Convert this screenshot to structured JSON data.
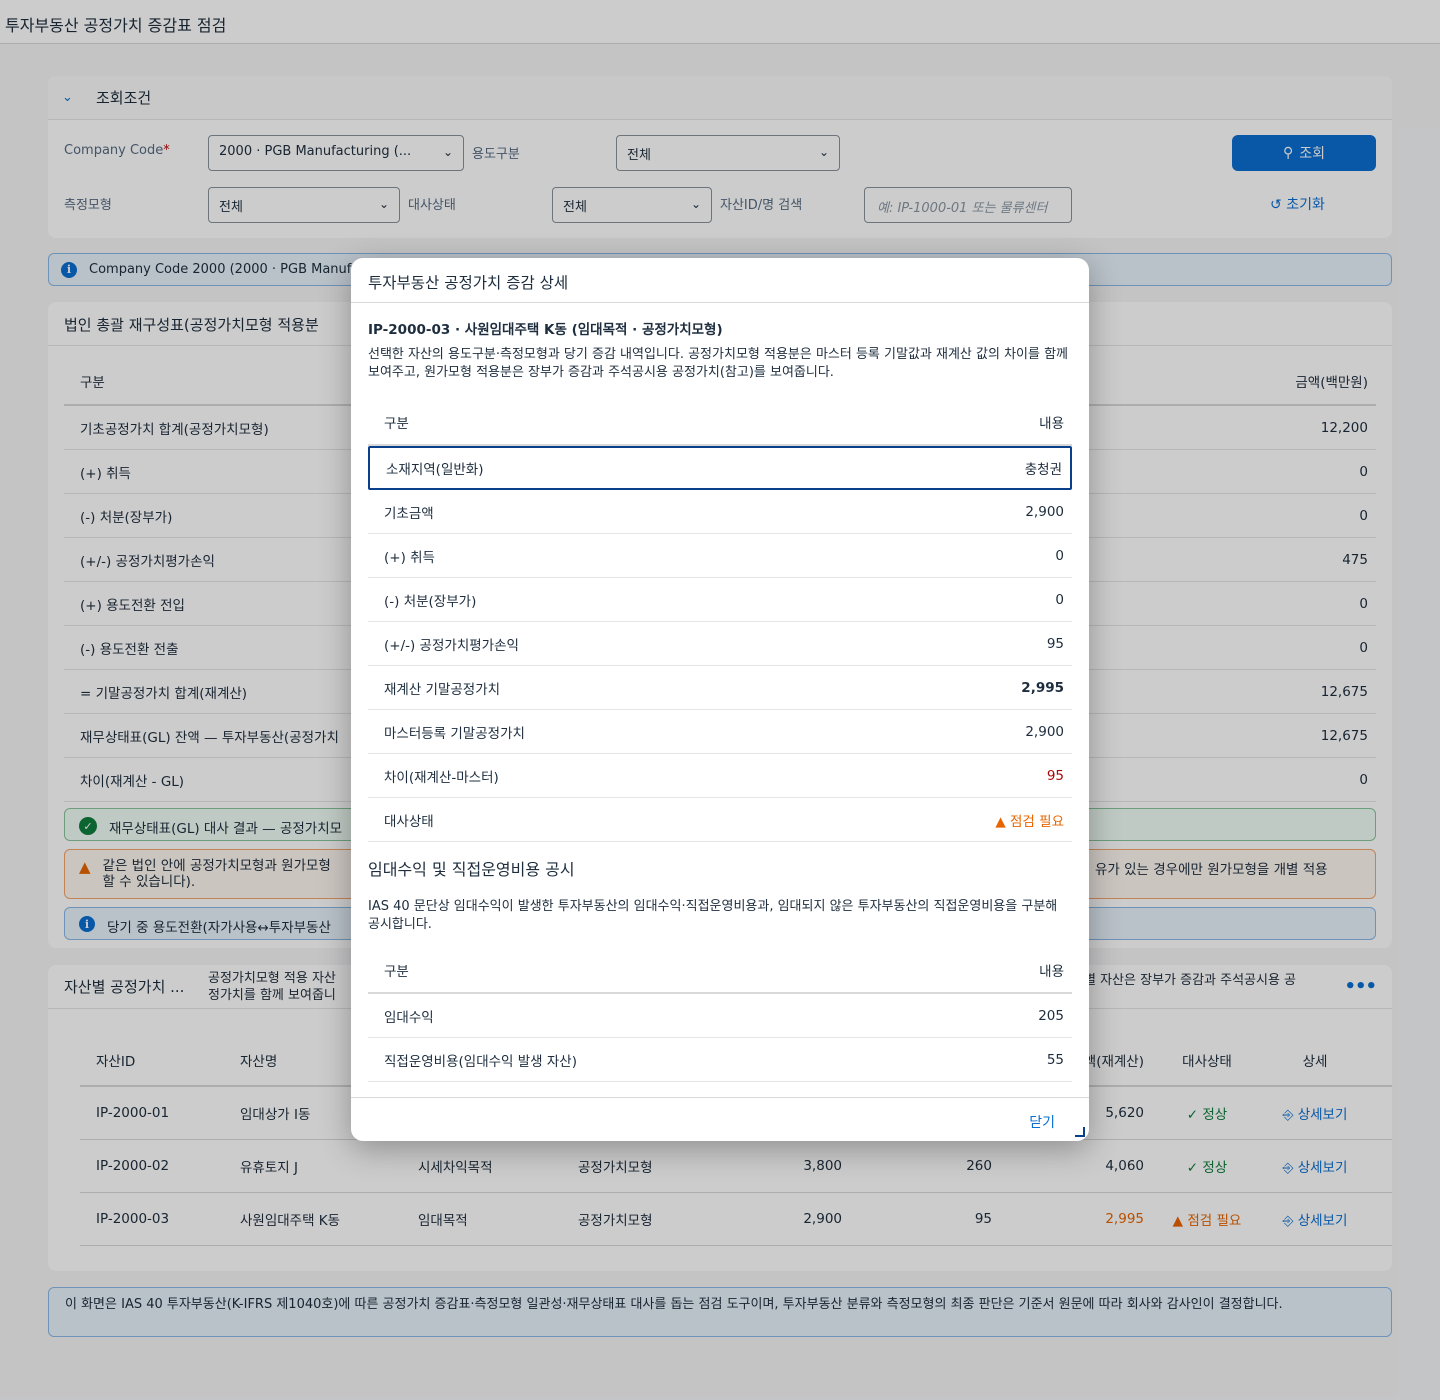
{
  "page": {
    "title": "투자부동산 공정가치 증감표 점검"
  },
  "filter": {
    "section_title": "조회조건",
    "company_label": "Company Code",
    "company_required": "*",
    "company_value": "2000 · PGB Manufacturing (...",
    "usage_label": "용도구분",
    "usage_value": "전체",
    "measure_label": "측정모형",
    "measure_value": "전체",
    "recon_label": "대사상태",
    "recon_value": "전체",
    "search_label": "자산ID/명 검색",
    "search_placeholder": "예: IP-1000-01 또는 물류센터",
    "search_button": "조회",
    "reset_button": "초기화"
  },
  "info_strip": {
    "text": "Company Code 2000 (2000 · PGB Manufac"
  },
  "recon": {
    "title": "법인 총괄 재구성표(공정가치모형 적용분",
    "col_label": "구분",
    "col_amount": "금액(백만원)",
    "rows": [
      {
        "label": "기초공정가치 합계(공정가치모형)",
        "amount": "12,200"
      },
      {
        "label": "(+) 취득",
        "amount": "0"
      },
      {
        "label": "(-) 처분(장부가)",
        "amount": "0"
      },
      {
        "label": "(+/-) 공정가치평가손익",
        "amount": "475"
      },
      {
        "label": "(+) 용도전환 전입",
        "amount": "0"
      },
      {
        "label": "(-) 용도전환 전출",
        "amount": "0"
      },
      {
        "label": "= 기말공정가치 합계(재계산)",
        "amount": "12,675"
      },
      {
        "label": "재무상태표(GL) 잔액 — 투자부동산(공정가치",
        "amount": "12,675"
      },
      {
        "label": "차이(재계산 - GL)",
        "amount": "0"
      }
    ],
    "msg_ok": "재무상태표(GL) 대사 결과 — 공정가치모",
    "msg_warn_left": "같은 법인 안에 공정가치모형과 원가모형",
    "msg_warn_left2": "할 수 있습니다).",
    "msg_warn_right": "유가 있는 경우에만 원가모형을 개별 적용",
    "msg_info": "당기 중 용도전환(자가사용↔투자부동산"
  },
  "assets": {
    "title": "자산별 공정가치 ...",
    "desc_left": "공정가치모형 적용 자산",
    "desc_left2": "정가치를 함께 보여줍니",
    "desc_right": "별 자산은 장부가 증감과 주석공시용 공",
    "more": "•••",
    "headers": {
      "id": "자산ID",
      "name": "자산명",
      "end": "액(재계산)",
      "status": "대사상태",
      "detail": "상세"
    },
    "rows": [
      {
        "id": "IP-2000-01",
        "name": "임대상가 I동",
        "usage": "",
        "model": "",
        "begin": "",
        "gain": "",
        "end": "5,620",
        "status": "정상",
        "detail": "상세보기"
      },
      {
        "id": "IP-2000-02",
        "name": "유휴토지 J",
        "usage": "시세차익목적",
        "model": "공정가치모형",
        "begin": "3,800",
        "gain": "260",
        "end": "4,060",
        "status": "정상",
        "detail": "상세보기"
      },
      {
        "id": "IP-2000-03",
        "name": "사원임대주택 K동",
        "usage": "임대목적",
        "model": "공정가치모형",
        "begin": "2,900",
        "gain": "95",
        "end": "2,995",
        "status": "점검 필요",
        "detail": "상세보기"
      }
    ]
  },
  "footer": {
    "note": "이 화면은 IAS 40 투자부동산(K-IFRS 제1040호)에 따른 공정가치 증감표·측정모형 일관성·재무상태표 대사를 돕는 점검 도구이며, 투자부동산 분류와 측정모형의 최종 판단은 기준서 원문에 따라 회사와 감사인이 결정합니다."
  },
  "dialog": {
    "title": "투자부동산 공정가치 증감 상세",
    "subtitle": "IP-2000-03 · 사원임대주택 K동 (임대목적 · 공정가치모형)",
    "desc": "선택한 자산의 용도구분·측정모형과 당기 증감 내역입니다. 공정가치모형 적용분은 마스터 등록 기말값과 재계산 값의 차이를 함께 보여주고, 원가모형 적용분은 장부가 증감과 주석공시용 공정가치(참고)를 보여줍니다.",
    "col_label": "구분",
    "col_value": "내용",
    "rows": [
      {
        "label": "소재지역(일반화)",
        "value": "충청권"
      },
      {
        "label": "기초금액",
        "value": "2,900"
      },
      {
        "label": "(+) 취득",
        "value": "0"
      },
      {
        "label": "(-) 처분(장부가)",
        "value": "0"
      },
      {
        "label": "(+/-) 공정가치평가손익",
        "value": "95"
      },
      {
        "label": "재계산 기말공정가치",
        "value": "2,995"
      },
      {
        "label": "마스터등록 기말공정가치",
        "value": "2,900"
      },
      {
        "label": "차이(재계산-마스터)",
        "value": "95"
      },
      {
        "label": "대사상태",
        "value": "점검 필요"
      }
    ],
    "section2_title": "임대수익 및 직접운영비용 공시",
    "section2_desc": "IAS 40 문단상 임대수익이 발생한 투자부동산의 임대수익·직접운영비용과, 임대되지 않은 투자부동산의 직접운영비용을 구분해 공시합니다.",
    "rows2": [
      {
        "label": "임대수익",
        "value": "205"
      },
      {
        "label": "직접운영비용(임대수익 발생 자산)",
        "value": "55"
      }
    ],
    "close": "닫기"
  }
}
